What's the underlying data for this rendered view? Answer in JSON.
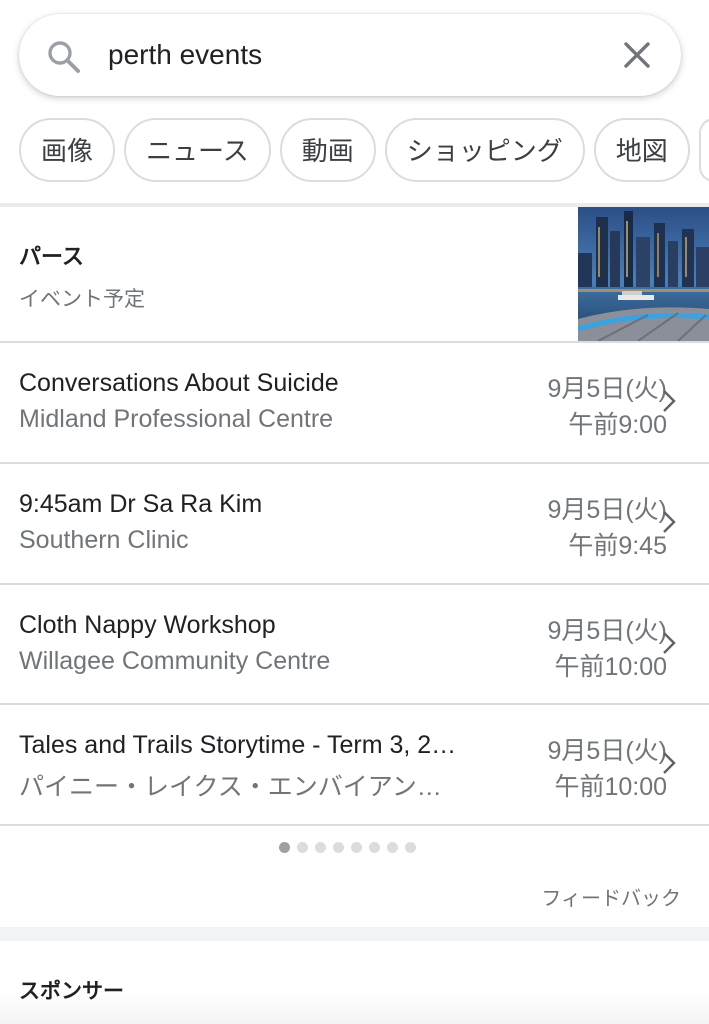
{
  "search": {
    "query": "perth events",
    "icon": "search-icon",
    "clear_icon": "close-icon"
  },
  "chips": [
    {
      "label": "画像"
    },
    {
      "label": "ニュース"
    },
    {
      "label": "動画"
    },
    {
      "label": "ショッピング"
    },
    {
      "label": "地図"
    }
  ],
  "events_header": {
    "title": "パース",
    "subtitle": "イベント予定"
  },
  "events": [
    {
      "name": "Conversations About Suicide",
      "venue": "Midland Professional Centre",
      "date": "9月5日(火)",
      "time": "午前9:00"
    },
    {
      "name": "9:45am Dr Sa Ra Kim",
      "venue": "Southern Clinic",
      "date": "9月5日(火)",
      "time": "午前9:45"
    },
    {
      "name": "Cloth Nappy Workshop",
      "venue": "Willagee Community Centre",
      "date": "9月5日(火)",
      "time": "午前10:00"
    },
    {
      "name": "Tales and Trails Storytime - Term 3, 2…",
      "venue": "パイニー・レイクス・エンバイアン…",
      "date": "9月5日(火)",
      "time": "午前10:00"
    }
  ],
  "pagination": {
    "total": 8,
    "active": 1
  },
  "feedback_label": "フィードバック",
  "sponsored_label": "スポンサー",
  "colors": {
    "text_primary": "#202124",
    "text_secondary": "#70757a",
    "divider": "#dadce0",
    "dot_active": "#9aa0a6"
  }
}
